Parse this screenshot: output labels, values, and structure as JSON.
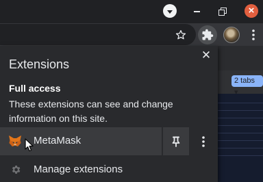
{
  "window": {
    "minimize_icon": "triangle-down-icon",
    "close_glyph": "×"
  },
  "toolbar": {
    "star_icon": "star-outline-icon",
    "extensions_icon": "puzzle-icon",
    "menu_icon": "three-dots-vertical-icon"
  },
  "page": {
    "tabs_pill": "2 tabs ▾"
  },
  "popup": {
    "title": "Extensions",
    "close_glyph": "✕",
    "section_heading": "Full access",
    "section_description": "These extensions can see and change information on this site.",
    "extensions": [
      {
        "name": "MetaMask",
        "icon": "metamask-fox-icon",
        "pinned": false
      }
    ],
    "manage_label": "Manage extensions"
  },
  "colors": {
    "titlebar": "#202124",
    "toolbar": "#35363a",
    "popup_bg": "#292a2d",
    "row_hover": "#3a3b3e",
    "close_red": "#e25f3f",
    "accent_blue": "#8ab4f8"
  }
}
